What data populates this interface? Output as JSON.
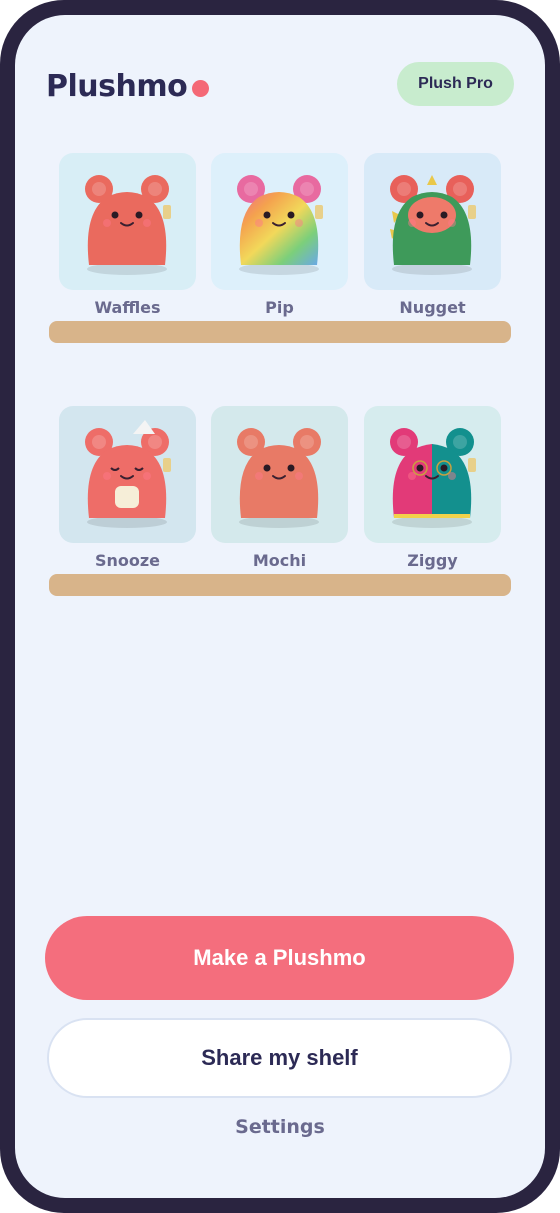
{
  "app": {
    "name": "Plushmo"
  },
  "header": {
    "pro_label": "Plush Pro"
  },
  "shelves": [
    {
      "items": [
        {
          "name": "Waffles",
          "tile_bg": "#d8eef6",
          "body": "#ea6a5e",
          "ear": "#ea6a5e",
          "belly": "#f08a7c",
          "style": "bear"
        },
        {
          "name": "Pip",
          "tile_bg": "#ddf0fb",
          "body": "#f2a25c",
          "ear": "#e86aa0",
          "belly": "#9ad07a",
          "style": "rainbow"
        },
        {
          "name": "Nugget",
          "tile_bg": "#d8eaf8",
          "body": "#3e9a5a",
          "ear": "#e8605a",
          "belly": "#ee7a6a",
          "style": "dino"
        }
      ]
    },
    {
      "items": [
        {
          "name": "Snooze",
          "tile_bg": "#d3e6ef",
          "body": "#ee6d68",
          "ear": "#ee6d68",
          "belly": "#f08e86",
          "style": "sleepy"
        },
        {
          "name": "Mochi",
          "tile_bg": "#d4e9ec",
          "body": "#e87a66",
          "ear": "#e87a66",
          "belly": "#ee8e7a",
          "style": "knit"
        },
        {
          "name": "Ziggy",
          "tile_bg": "#d6ecee",
          "body": "#e23a78",
          "ear": "#e23a78",
          "belly": "#13908e",
          "style": "split"
        }
      ]
    }
  ],
  "actions": {
    "make_label": "Make a Plushmo",
    "share_label": "Share my shelf",
    "settings_label": "Settings"
  }
}
